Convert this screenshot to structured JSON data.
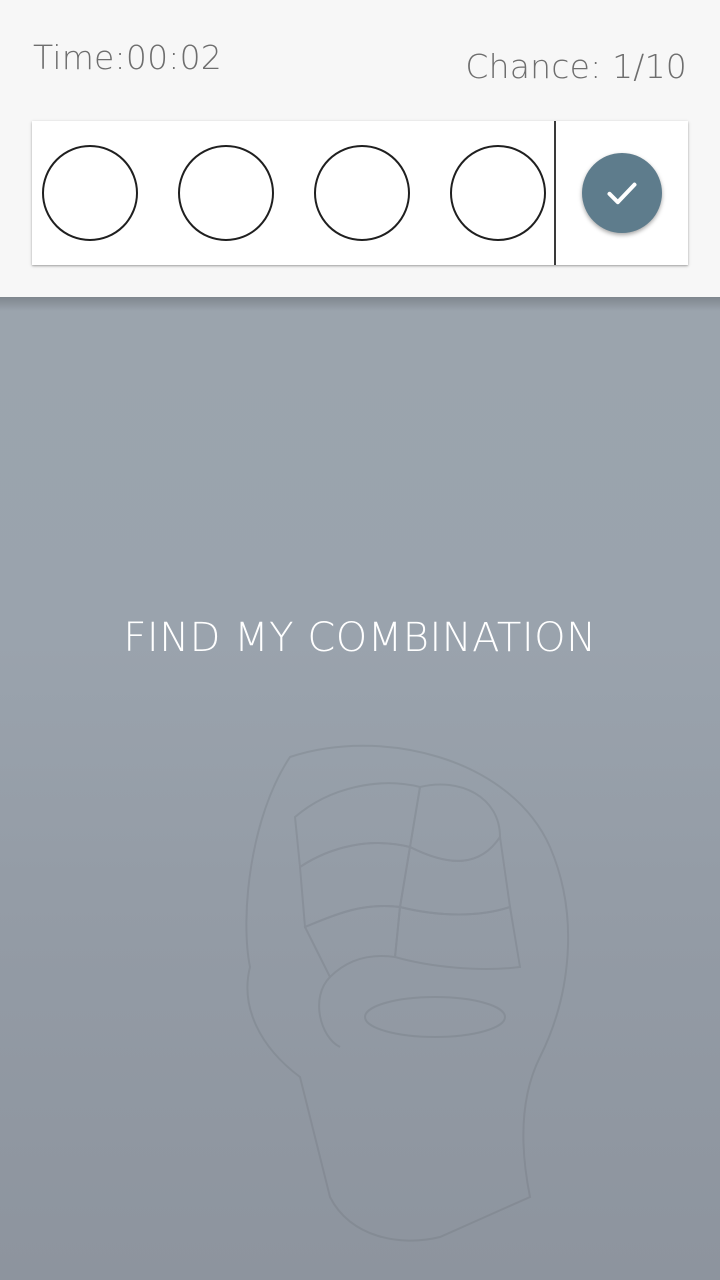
{
  "header": {
    "timer_text": "Time:00:02",
    "chance_text": "Chance: 1/10"
  },
  "guess_row": {
    "slots": [
      {
        "color": "#ffffff"
      },
      {
        "color": "#ffffff"
      },
      {
        "color": "#ffffff"
      },
      {
        "color": "#ffffff"
      }
    ],
    "submit_icon": "check-icon",
    "submit_color": "#5e7c8c"
  },
  "board": {
    "message": "FIND MY COMBINATION",
    "background_icon": "phrenology-head-icon"
  }
}
